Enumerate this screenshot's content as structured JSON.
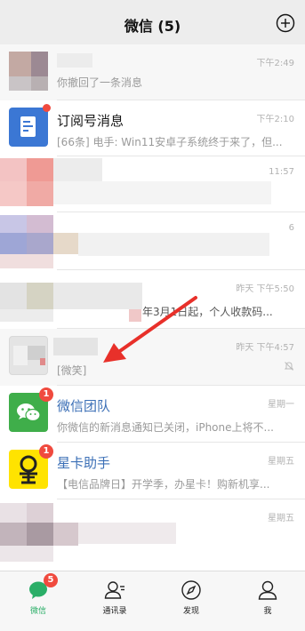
{
  "header": {
    "title": "微信 (5)"
  },
  "chats": [
    {
      "name": "",
      "preview": "你撤回了一条消息",
      "time": "下午2:49"
    },
    {
      "name": "订阅号消息",
      "preview": "[66条] 电手: Win11安卓子系统终于来了，但...",
      "time": "下午2:10"
    },
    {
      "name": "",
      "preview": "",
      "time": "11:57"
    },
    {
      "name": "",
      "preview": "",
      "time": "6"
    },
    {
      "name": "",
      "preview": "年3月1日起，个人收款码...",
      "time": "昨天 下午5:50"
    },
    {
      "name": "",
      "preview": "[微笑]",
      "time": "昨天 下午4:57"
    },
    {
      "name": "微信团队",
      "preview": "你微信的新消息通知已关闭，iPhone上将不...",
      "time": "星期一",
      "badge": "1"
    },
    {
      "name": "星卡助手",
      "preview": "【电信品牌日】开学季，办星卡！购新机享...",
      "time": "星期五",
      "badge": "1"
    },
    {
      "name": "",
      "preview": "",
      "time": "星期五"
    }
  ],
  "tabbar": {
    "tabs": [
      {
        "label": "微信",
        "badge": "5"
      },
      {
        "label": "通讯录"
      },
      {
        "label": "发现"
      },
      {
        "label": "我"
      }
    ]
  },
  "colors": {
    "accent": "#2aae67",
    "badge": "#f04a3e",
    "annotation_arrow": "#e8302a"
  }
}
